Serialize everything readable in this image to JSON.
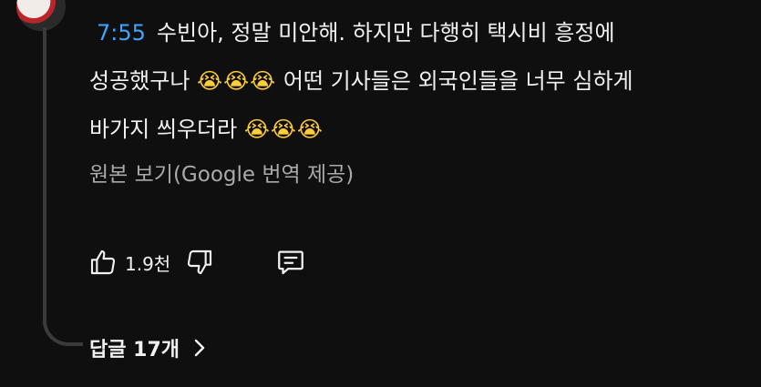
{
  "comment": {
    "timestamp": "7:55",
    "line1": "수빈아, 정말 미안해. 하지만 다행히 택시비 흥정에",
    "line2_a": "성공했구나",
    "line2_emoji": "😭😭😭",
    "line2_b": "어떤 기사들은 외국인들을 너무 심하게",
    "line3_a": "바가지 씌우더라",
    "line3_emoji": "😭😭😭"
  },
  "translation": {
    "label": "원본 보기(Google 번역 제공)"
  },
  "actions": {
    "like_count": "1.9천",
    "like_icon": "thumbs-up-icon",
    "dislike_icon": "thumbs-down-icon",
    "reply_icon": "comment-icon"
  },
  "replies": {
    "label": "답글 17개",
    "chevron_icon": "chevron-right-icon"
  },
  "colors": {
    "background": "#0f0f0f",
    "timestamp": "#3ea6ff",
    "text": "#f1f1f1",
    "muted": "#aaaaaa",
    "thread_line": "#3a3a3a"
  }
}
